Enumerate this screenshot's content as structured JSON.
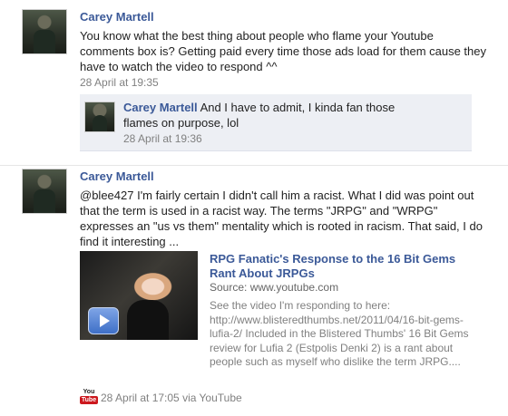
{
  "post1": {
    "author": "Carey Martell",
    "text": "You know what the best thing about people who flame your Youtube comments box is? Getting paid every time those ads load for them cause they have to watch the video to respond ^^",
    "timestamp": "28 April at 19:35",
    "reply": {
      "author": "Carey Martell",
      "text": "And I have to admit, I kinda fan those flames on purpose, lol",
      "timestamp": "28 April at 19:36"
    }
  },
  "post2": {
    "author": "Carey Martell",
    "text": "@blee427 I'm fairly certain I didn't call him a racist. What I did was point out that the term is used in a racist way. The terms \"JRPG\" and \"WRPG\" expresses an \"us vs them\" mentality which is rooted in racism. That said, I do find it interesting ...",
    "video": {
      "title": "RPG Fanatic's Response to the 16 Bit Gems Rant About JRPGs",
      "source": "Source: www.youtube.com",
      "description": "See the video I'm responding to here: http://www.blisteredthumbs.net/2011/04/16-bit-gems-lufia-2/ Included in the Blistered Thumbs' 16 Bit Gems review for Lufia 2 (Estpolis Denki 2) is a rant about people such as myself who dislike the term JRPG...."
    },
    "icon_you": "You",
    "icon_tube": "Tube",
    "timestamp": "28 April at 17:05 via YouTube"
  },
  "colors": {
    "link": "#3b5998",
    "meta": "#808080",
    "reply_bg": "#edeff4",
    "youtube_red": "#cc181e"
  },
  "icons": [
    "avatar",
    "play-icon",
    "youtube-icon"
  ]
}
